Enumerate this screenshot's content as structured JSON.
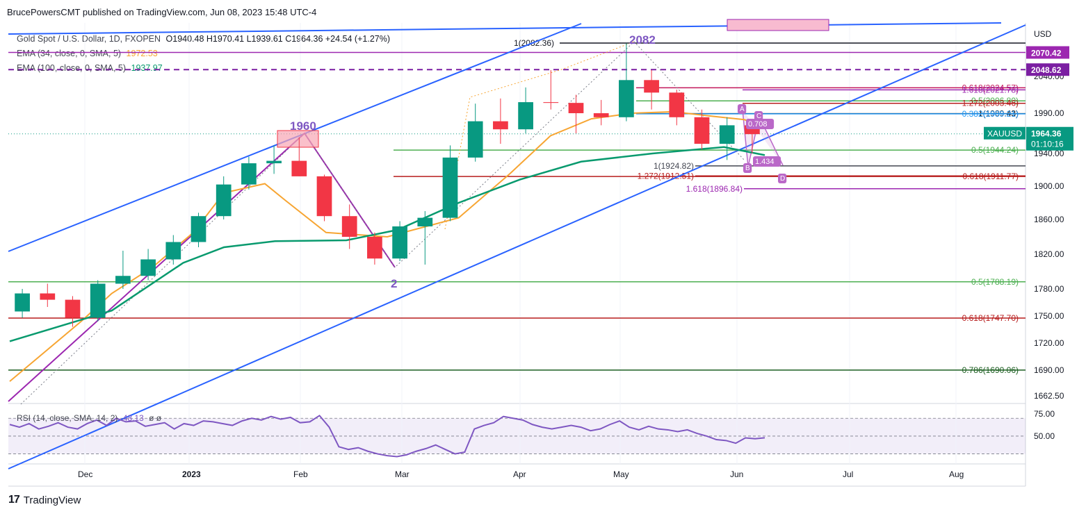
{
  "header": {
    "publisher": "BrucePowersCMT published on TradingView.com, Jun 08, 2023 15:48 UTC-4"
  },
  "legend": {
    "symbol": "Gold Spot / U.S. Dollar, 1D, FXOPEN",
    "ohlc": "O1940.48  H1970.41  L1939.61  C1964.36  +24.54 (+1.27%)",
    "ema34_label": "EMA (34, close, 0, SMA, 5)",
    "ema34_value": "1972.53",
    "ema100_label": "EMA (100, close, 0, SMA, 5)",
    "ema100_value": "1937.97"
  },
  "rsi_legend": {
    "label": "RSI (14, close, SMA, 14, 2)",
    "value": "48.13",
    "extra": "ø  ø"
  },
  "footer": {
    "logo": "17",
    "brand": "TradingView"
  },
  "colors": {
    "up": "#089981",
    "down": "#f23645",
    "ema34": "#f7a532",
    "ema100": "#089a6e",
    "channel": "#2962ff",
    "fib_green": "#4caf50",
    "fib_red": "#b71c1c",
    "purple": "#9c27b0",
    "rsi": "#7e57c2"
  },
  "chart_data": {
    "type": "candlestick",
    "currency": "USD",
    "ylim": [
      1650,
      2110
    ],
    "y_ticks": [
      "2040.00",
      "1990.00",
      "1940.00",
      "1900.00",
      "1860.00",
      "1820.00",
      "1780.00",
      "1750.00",
      "1720.00",
      "1690.00",
      "1662.50"
    ],
    "x_ticks": [
      "Dec",
      "2023",
      "Feb",
      "Mar",
      "Apr",
      "May",
      "Jun",
      "Jul",
      "Aug"
    ],
    "price_badges": [
      {
        "text": "2070.42",
        "value": 2070.42,
        "color": "#9c27b0"
      },
      {
        "text": "2048.62",
        "value": 2048.62,
        "color": "#7b1fa2"
      }
    ],
    "last_price": {
      "symbol": "XAUUSD",
      "price": "1964.36",
      "countdown": "01:10:16",
      "value": 1964.36
    },
    "ohlc_series": [
      {
        "d": "Nov 15",
        "o": 1755,
        "h": 1780,
        "l": 1748,
        "c": 1775
      },
      {
        "d": "Nov 22",
        "o": 1775,
        "h": 1786,
        "l": 1760,
        "c": 1768
      },
      {
        "d": "Nov 29",
        "o": 1768,
        "h": 1772,
        "l": 1738,
        "c": 1748
      },
      {
        "d": "Dec 06",
        "o": 1748,
        "h": 1790,
        "l": 1744,
        "c": 1786
      },
      {
        "d": "Dec 13",
        "o": 1786,
        "h": 1824,
        "l": 1780,
        "c": 1795
      },
      {
        "d": "Dec 20",
        "o": 1795,
        "h": 1826,
        "l": 1790,
        "c": 1814
      },
      {
        "d": "Dec 27",
        "o": 1814,
        "h": 1842,
        "l": 1808,
        "c": 1834
      },
      {
        "d": "Jan 03",
        "o": 1834,
        "h": 1868,
        "l": 1828,
        "c": 1864
      },
      {
        "d": "Jan 10",
        "o": 1864,
        "h": 1912,
        "l": 1860,
        "c": 1902
      },
      {
        "d": "Jan 17",
        "o": 1902,
        "h": 1936,
        "l": 1896,
        "c": 1928
      },
      {
        "d": "Jan 24",
        "o": 1928,
        "h": 1950,
        "l": 1915,
        "c": 1931
      },
      {
        "d": "Feb 01",
        "o": 1931,
        "h": 1960,
        "l": 1912,
        "c": 1912
      },
      {
        "d": "Feb 08",
        "o": 1912,
        "h": 1914,
        "l": 1858,
        "c": 1864
      },
      {
        "d": "Feb 15",
        "o": 1864,
        "h": 1878,
        "l": 1826,
        "c": 1840
      },
      {
        "d": "Feb 22",
        "o": 1840,
        "h": 1845,
        "l": 1808,
        "c": 1815
      },
      {
        "d": "Mar 01",
        "o": 1815,
        "h": 1858,
        "l": 1812,
        "c": 1852
      },
      {
        "d": "Mar 08",
        "o": 1852,
        "h": 1870,
        "l": 1808,
        "c": 1862
      },
      {
        "d": "Mar 15",
        "o": 1862,
        "h": 1950,
        "l": 1858,
        "c": 1935
      },
      {
        "d": "Mar 22",
        "o": 1935,
        "h": 2003,
        "l": 1930,
        "c": 1980
      },
      {
        "d": "Mar 29",
        "o": 1980,
        "h": 2010,
        "l": 1952,
        "c": 1970
      },
      {
        "d": "Apr 05",
        "o": 1970,
        "h": 2025,
        "l": 1965,
        "c": 2005
      },
      {
        "d": "Apr 12",
        "o": 2005,
        "h": 2048,
        "l": 1995,
        "c": 2004
      },
      {
        "d": "Apr 19",
        "o": 2004,
        "h": 2015,
        "l": 1965,
        "c": 1990
      },
      {
        "d": "Apr 26",
        "o": 1990,
        "h": 2008,
        "l": 1975,
        "c": 1985
      },
      {
        "d": "May 03",
        "o": 1985,
        "h": 2082,
        "l": 1980,
        "c": 2035
      },
      {
        "d": "May 10",
        "o": 2035,
        "h": 2048,
        "l": 1995,
        "c": 2018
      },
      {
        "d": "May 17",
        "o": 2018,
        "h": 2022,
        "l": 1975,
        "c": 1985
      },
      {
        "d": "May 24",
        "o": 1985,
        "h": 1995,
        "l": 1945,
        "c": 1952
      },
      {
        "d": "May 31",
        "o": 1952,
        "h": 1985,
        "l": 1932,
        "c": 1975
      },
      {
        "d": "Jun 07",
        "o": 1975,
        "h": 1983,
        "l": 1940,
        "c": 1964
      }
    ],
    "ema34": [
      [
        0,
        1678
      ],
      [
        7,
        1744
      ],
      [
        10,
        1775
      ],
      [
        14,
        1805
      ],
      [
        18,
        1845
      ],
      [
        21,
        1892
      ],
      [
        25,
        1903
      ],
      [
        27,
        1883
      ],
      [
        31,
        1845
      ],
      [
        37,
        1840
      ],
      [
        44,
        1862
      ],
      [
        49,
        1915
      ],
      [
        53,
        1962
      ],
      [
        57,
        1983
      ],
      [
        61,
        1990
      ],
      [
        65,
        1992
      ],
      [
        69,
        1986
      ],
      [
        72,
        1982
      ],
      [
        74,
        1972.53
      ]
    ],
    "ema100": [
      [
        0,
        1722
      ],
      [
        10,
        1756
      ],
      [
        17,
        1810
      ],
      [
        21,
        1828
      ],
      [
        26,
        1835
      ],
      [
        33,
        1836
      ],
      [
        38,
        1848
      ],
      [
        44,
        1880
      ],
      [
        50,
        1908
      ],
      [
        56,
        1930
      ],
      [
        63,
        1940
      ],
      [
        70,
        1948
      ],
      [
        74,
        1937.97
      ]
    ],
    "rsi": {
      "levels": [
        "75.00",
        "50.00"
      ],
      "band": [
        70,
        30
      ],
      "values": [
        63,
        60,
        64,
        58,
        61,
        65,
        60,
        58,
        64,
        68,
        62,
        70,
        66,
        67,
        61,
        63,
        65,
        58,
        64,
        62,
        67,
        66,
        64,
        62,
        67,
        70,
        68,
        72,
        69,
        71,
        65,
        66,
        73,
        60,
        38,
        35,
        37,
        33,
        30,
        28,
        27,
        29,
        33,
        36,
        40,
        35,
        30,
        32,
        58,
        62,
        65,
        72,
        70,
        68,
        63,
        60,
        58,
        60,
        62,
        60,
        56,
        58,
        63,
        67,
        60,
        57,
        61,
        58,
        57,
        55,
        57,
        53,
        50,
        46,
        45,
        42,
        48,
        47,
        48.13
      ],
      "last": "48.13"
    },
    "fibs": [
      {
        "label": "0.618(2024.57)",
        "value": 2024.57,
        "color": "#c2185b"
      },
      {
        "label": "1.618(2021.78)",
        "value": 2021.78,
        "color": "#9c27b0"
      },
      {
        "label": "0.5(2006.80)",
        "value": 2006.8,
        "color": "#4caf50"
      },
      {
        "label": "1.272(2003.46)",
        "value": 2003.46,
        "color": "#b71c1c"
      },
      {
        "label": "1(1989.43)",
        "value": 1989.43,
        "color": "#000000"
      },
      {
        "label": "0.382(1989.21)",
        "value": 1989.21,
        "color": "#2196f3"
      },
      {
        "label": "0.5(1944.24)",
        "value": 1944.24,
        "color": "#4caf50"
      },
      {
        "label": "1(1924.82)",
        "value": 1924.82,
        "color": "#434651"
      },
      {
        "label": "1.272(1912.51)",
        "value": 1912.51,
        "color": "#b71c1c"
      },
      {
        "label": "0.618(1911.77)",
        "value": 1911.77,
        "color": "#b71c1c"
      },
      {
        "label": "1.618(1896.84)",
        "value": 1896.84,
        "color": "#9c27b0"
      },
      {
        "label": "0.5(1788.19)",
        "value": 1788.19,
        "color": "#4caf50"
      },
      {
        "label": "0.618(1747.70)",
        "value": 1747.7,
        "color": "#b71c1c"
      },
      {
        "label": "0.786(1690.06)",
        "value": 1690.06,
        "color": "#1b5e20"
      },
      {
        "label": "1(2082.36)",
        "value": 2082.36,
        "color": "#131722"
      }
    ],
    "annotations": [
      "1960",
      "2082",
      "2",
      "A",
      "C",
      "B",
      "D",
      "0.708",
      "1.434"
    ]
  }
}
